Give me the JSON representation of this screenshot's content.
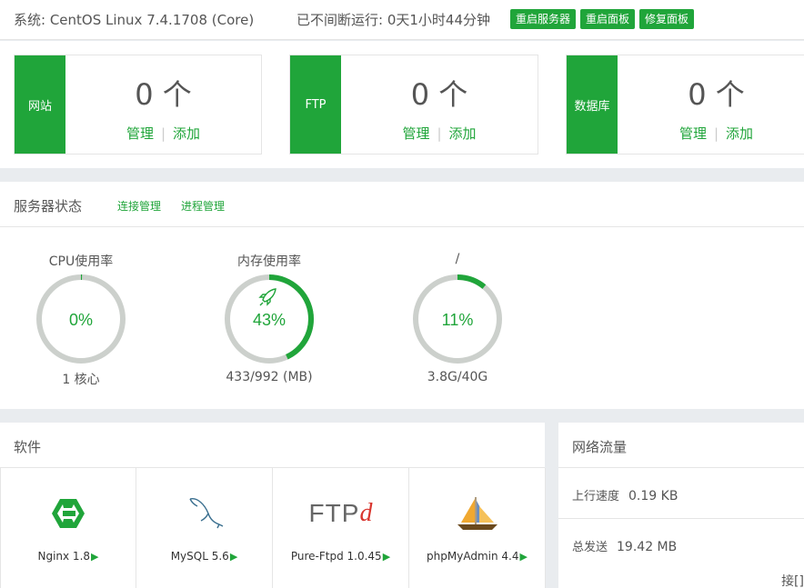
{
  "topbar": {
    "system": "系统: CentOS Linux 7.4.1708 (Core)",
    "uptime": "已不间断运行: 0天1小时44分钟",
    "buttons": [
      "重启服务器",
      "重启面板",
      "修复面板"
    ]
  },
  "stats": [
    {
      "label": "网站",
      "count": "0 个",
      "manage": "管理",
      "add": "添加"
    },
    {
      "label": "FTP",
      "count": "0 个",
      "manage": "管理",
      "add": "添加"
    },
    {
      "label": "数据库",
      "count": "0 个",
      "manage": "管理",
      "add": "添加"
    }
  ],
  "server_status": {
    "title": "服务器状态",
    "links": [
      "连接管理",
      "进程管理"
    ],
    "gauges": [
      {
        "title": "CPU使用率",
        "percent": 0,
        "value": "0%",
        "detail": "1 核心"
      },
      {
        "title": "内存使用率",
        "percent": 43,
        "value": "43%",
        "detail": "433/992 (MB)",
        "icon": "rocket-icon"
      },
      {
        "title": "/",
        "percent": 11,
        "value": "11%",
        "detail": "3.8G/40G"
      }
    ]
  },
  "software": {
    "title": "软件",
    "apps": [
      {
        "name": "Nginx 1.8",
        "icon": "nginx-icon"
      },
      {
        "name": "MySQL 5.6",
        "icon": "mysql-dolphin-icon"
      },
      {
        "name": "Pure-Ftpd 1.0.45",
        "icon": "ftpd-icon",
        "logo_text": "FTP",
        "logo_accent": "d"
      },
      {
        "name": "phpMyAdmin 4.4",
        "icon": "sailboat-icon"
      }
    ]
  },
  "network": {
    "title": "网络流量",
    "upload_label": "上行速度",
    "upload_value": "0.19 KB",
    "total_label": "总发送",
    "total_value": "19.42 MB",
    "tail": "接[]"
  },
  "colors": {
    "accent": "#20a53a",
    "track": "#ccd0cc"
  }
}
